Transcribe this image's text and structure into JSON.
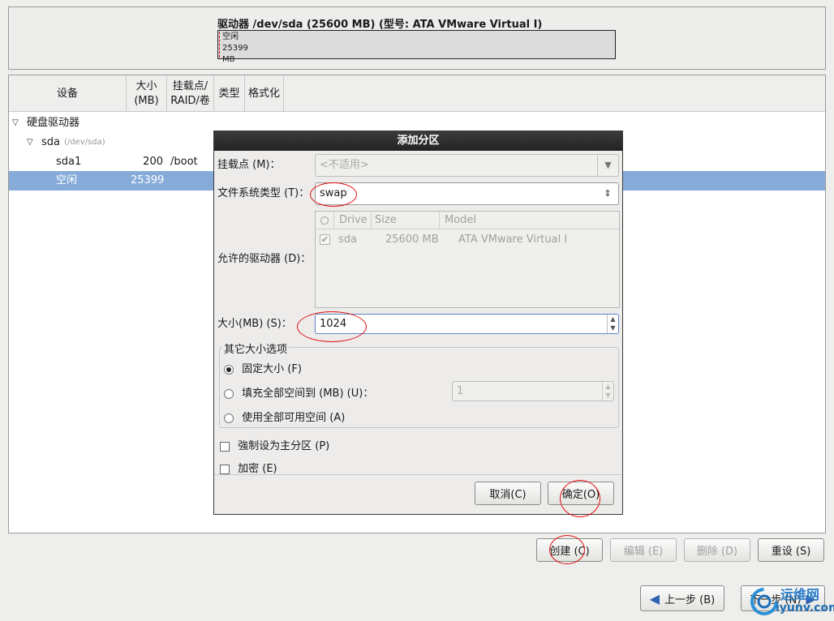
{
  "drive": {
    "title": "驱动器 /dev/sda (25600 MB) (型号: ATA VMware Virtual I)",
    "free_label": "空闲",
    "free_size": "25399 MB"
  },
  "table": {
    "columns": [
      "设备",
      "大小\n(MB)",
      "挂载点/\nRAID/卷",
      "类型",
      "格式化"
    ],
    "rows": [
      {
        "device": "硬盘驱动器",
        "size": "",
        "mount": "",
        "level": 0,
        "expander": true
      },
      {
        "device": "sda",
        "sub": "(/dev/sda)",
        "size": "",
        "mount": "",
        "level": 1,
        "expander": true
      },
      {
        "device": "sda1",
        "size": "200",
        "mount": "/boot",
        "level": 2,
        "expander": false
      },
      {
        "device": "空闲",
        "size": "25399",
        "mount": "",
        "level": 2,
        "expander": false,
        "selected": true
      }
    ]
  },
  "buttons": {
    "create": "创建 (C)",
    "edit": "编辑 (E)",
    "delete": "删除 (D)",
    "reset": "重设 (S)",
    "back": "上一步 (B)",
    "next": "下一步 (N)"
  },
  "dialog": {
    "title": "添加分区",
    "mount_label": "挂载点 (M)：",
    "mount_value": "<不适用>",
    "fs_label": "文件系统类型 (T)：",
    "fs_value": "swap",
    "drives_label": "允许的驱动器 (D)：",
    "drives_columns": [
      "Drive",
      "Size",
      "Model"
    ],
    "drives_row": {
      "drive": "sda",
      "size": "25600 MB",
      "model": "ATA VMware Virtual I"
    },
    "size_label": "大小(MB) (S)：",
    "size_value": "1024",
    "options_title": "其它大小选项",
    "opt_fixed": "固定大小 (F)",
    "opt_fill": "填充全部空间到 (MB) (U)：",
    "opt_fill_value": "1",
    "opt_all": "使用全部可用空间 (A)",
    "force_primary": "強制设为主分区 (P)",
    "encrypt": "加密 (E)",
    "cancel": "取消(C)",
    "ok": "确定(O)"
  },
  "watermark": {
    "cn": "运维网",
    "url": "iyunv.com"
  },
  "colors": {
    "selection": "#86abd9",
    "annotation": "#e01010"
  }
}
